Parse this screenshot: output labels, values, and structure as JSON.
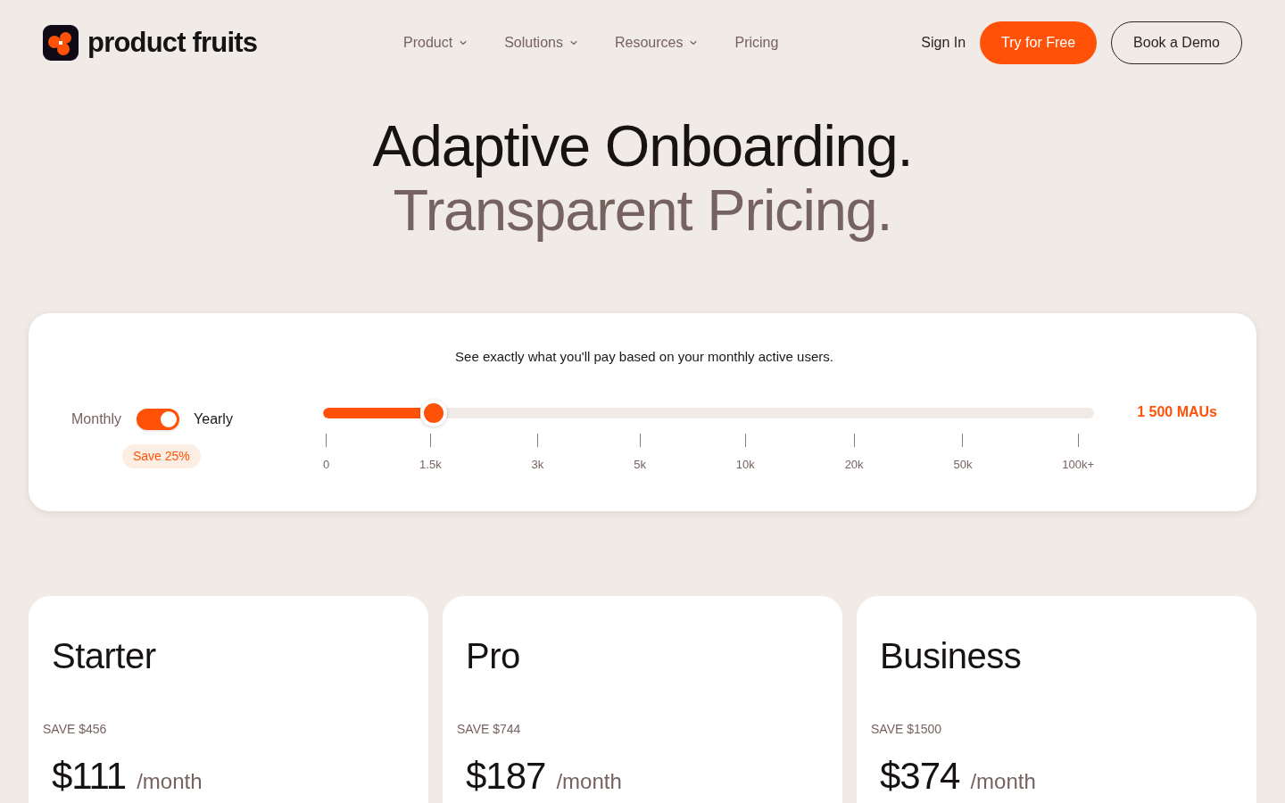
{
  "nav": {
    "logo": "product fruits",
    "links": [
      {
        "label": "Product",
        "dropdown": true
      },
      {
        "label": "Solutions",
        "dropdown": true
      },
      {
        "label": "Resources",
        "dropdown": true
      },
      {
        "label": "Pricing",
        "dropdown": false
      }
    ],
    "sign_in": "Sign In",
    "try_button": "Try for Free",
    "demo_button": "Book a Demo"
  },
  "hero": {
    "line_1": "Adaptive Onboarding.",
    "line_2": "Transparent Pricing."
  },
  "calculator": {
    "caption": "See exactly what you'll pay based on your monthly active users.",
    "billing": {
      "left_label": "Monthly",
      "right_label": "Yearly",
      "yearly": true,
      "badge": "Save 25%"
    },
    "slider": {
      "level": 0.143,
      "ticks": [
        "0",
        "1.5k",
        "3k",
        "5k",
        "10k",
        "20k",
        "50k",
        "100k+"
      ],
      "reading": "1 500 MAUs"
    }
  },
  "plans": [
    {
      "name": "Starter",
      "savings": "SAVE $456",
      "price": "$111",
      "period": "/month"
    },
    {
      "name": "Pro",
      "savings": "SAVE $744",
      "price": "$187",
      "period": "/month"
    },
    {
      "name": "Business",
      "savings": "SAVE $1500",
      "price": "$374",
      "period": "/month"
    }
  ]
}
